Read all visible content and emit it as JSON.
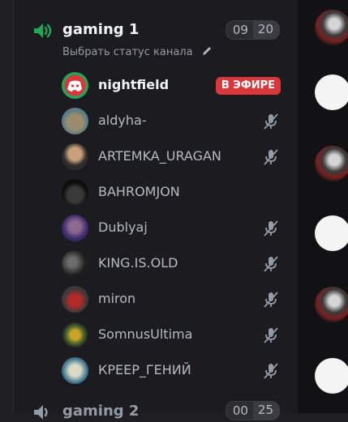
{
  "channel": {
    "name": "gaming 1",
    "count_current": "09",
    "count_max": "20",
    "status": "Выбрать статус канала"
  },
  "users": [
    {
      "name": "nightfield",
      "live": "В ЭФИРЕ"
    },
    {
      "name": "aldyha-"
    },
    {
      "name": "ARTEMKA_URAGAN"
    },
    {
      "name": "BAHROMJON"
    },
    {
      "name": "Dublyaj"
    },
    {
      "name": "KING.IS.OLD"
    },
    {
      "name": "miron"
    },
    {
      "name": "SomnusUltima"
    },
    {
      "name": "КРЕЕР_ГЕНИЙ"
    }
  ],
  "next_channel": {
    "name": "gaming 2",
    "count_current": "00",
    "count_max": "25"
  },
  "colors": {
    "accent_green": "#23a55a",
    "live_red": "#da373c",
    "discord_blurple": "#5865f2"
  }
}
